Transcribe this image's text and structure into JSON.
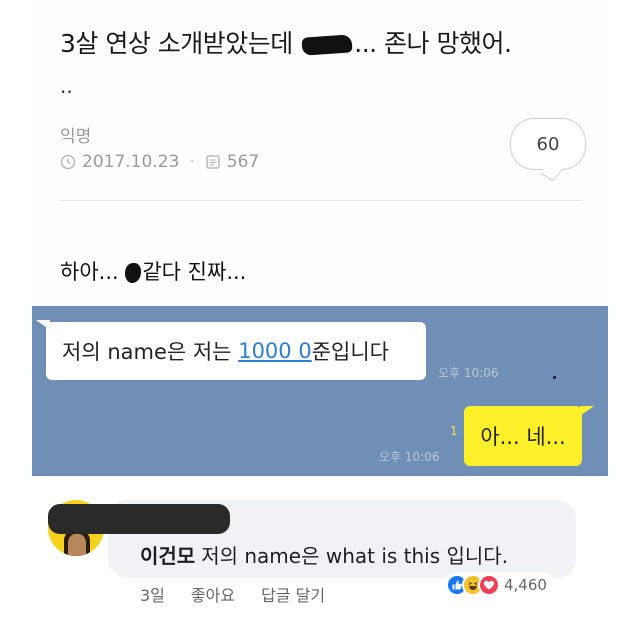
{
  "post": {
    "title_before": "3살 연상 소개받았는데",
    "title_after": "... 존나 망했어.",
    "continuation": "..",
    "author": "익명",
    "date": "2017.10.23",
    "views": "567",
    "comment_count": "60",
    "body_before": "하아...",
    "body_after": "같다 진짜..."
  },
  "chat": {
    "incoming": {
      "before": "저의 name은 저는 ",
      "link": "1000 0",
      "after": "준입니다",
      "time": "오후 10:06"
    },
    "outgoing": {
      "text": "아... 네...",
      "read_count": "1",
      "time": "오후 10:06"
    },
    "colors": {
      "background": "#6f8fb6",
      "outgoing_bubble": "#fdf02a",
      "incoming_bubble": "#ffffff"
    }
  },
  "comment": {
    "name": "이건모",
    "text": "저의 name은 what is this 입니다.",
    "actions": [
      "3일",
      "좋아요",
      "답글 달기"
    ],
    "reactions": {
      "icons": [
        "like-icon",
        "haha-icon",
        "love-icon"
      ],
      "count": "4,460"
    }
  }
}
